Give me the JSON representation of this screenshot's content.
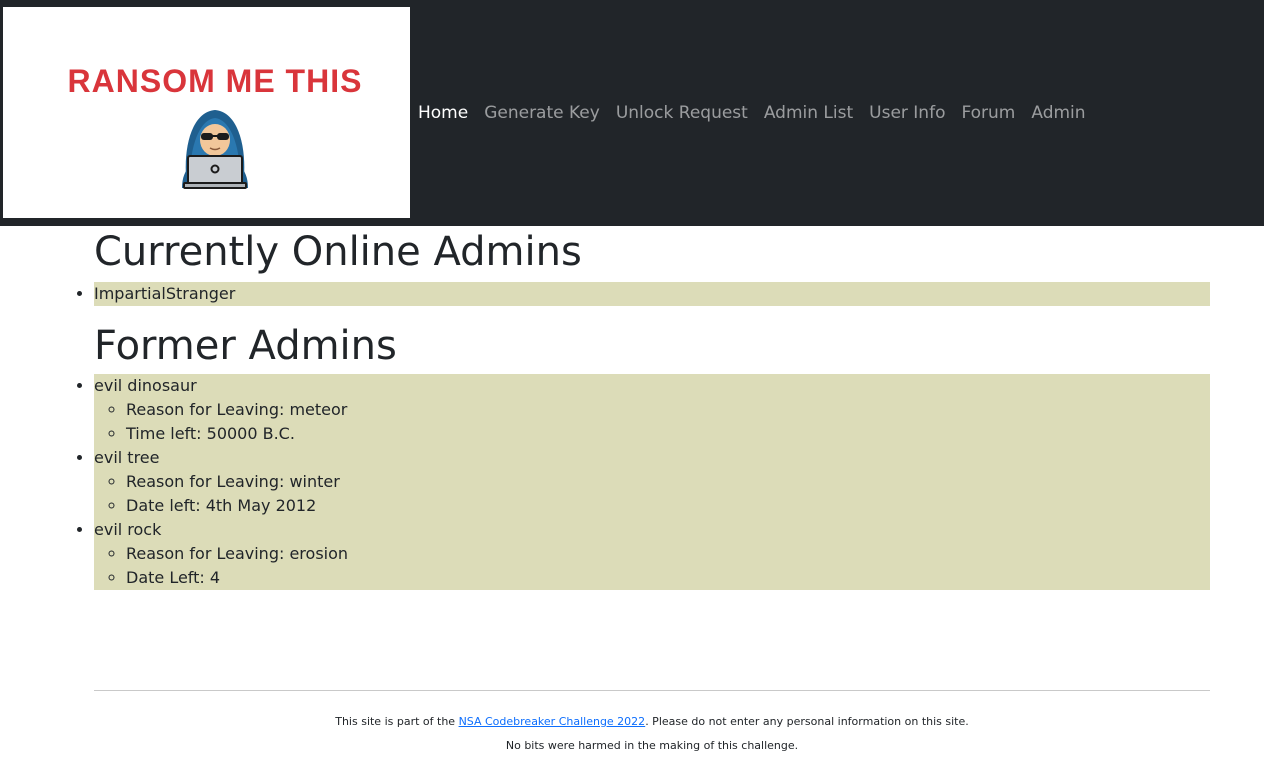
{
  "logo": {
    "text": "RANSOM ME THIS",
    "brand_color": "#d9353b",
    "icon": "hacker-laptop-icon"
  },
  "nav": {
    "items": [
      {
        "label": "Home",
        "active": true
      },
      {
        "label": "Generate Key",
        "active": false
      },
      {
        "label": "Unlock Request",
        "active": false
      },
      {
        "label": "Admin List",
        "active": false
      },
      {
        "label": "User Info",
        "active": false
      },
      {
        "label": "Forum",
        "active": false
      },
      {
        "label": "Admin",
        "active": false
      }
    ]
  },
  "main": {
    "online_heading": "Currently Online Admins",
    "online_admins": [
      "ImpartialStranger"
    ],
    "former_heading": "Former Admins",
    "former_admins": [
      {
        "name": "evil dinosaur",
        "details": [
          "Reason for Leaving: meteor",
          "Time left: 50000 B.C."
        ]
      },
      {
        "name": "evil tree",
        "details": [
          "Reason for Leaving: winter",
          "Date left: 4th May 2012"
        ]
      },
      {
        "name": "evil rock",
        "details": [
          "Reason for Leaving: erosion",
          "Date Left: 4"
        ]
      }
    ],
    "list_bg_color": "#dcdcb8"
  },
  "footer": {
    "line1_prefix": "This site is part of the ",
    "line1_link": "NSA Codebreaker Challenge 2022",
    "line1_suffix": ". Please do not enter any personal information on this site.",
    "line2": "No bits were harmed in the making of this challenge."
  }
}
